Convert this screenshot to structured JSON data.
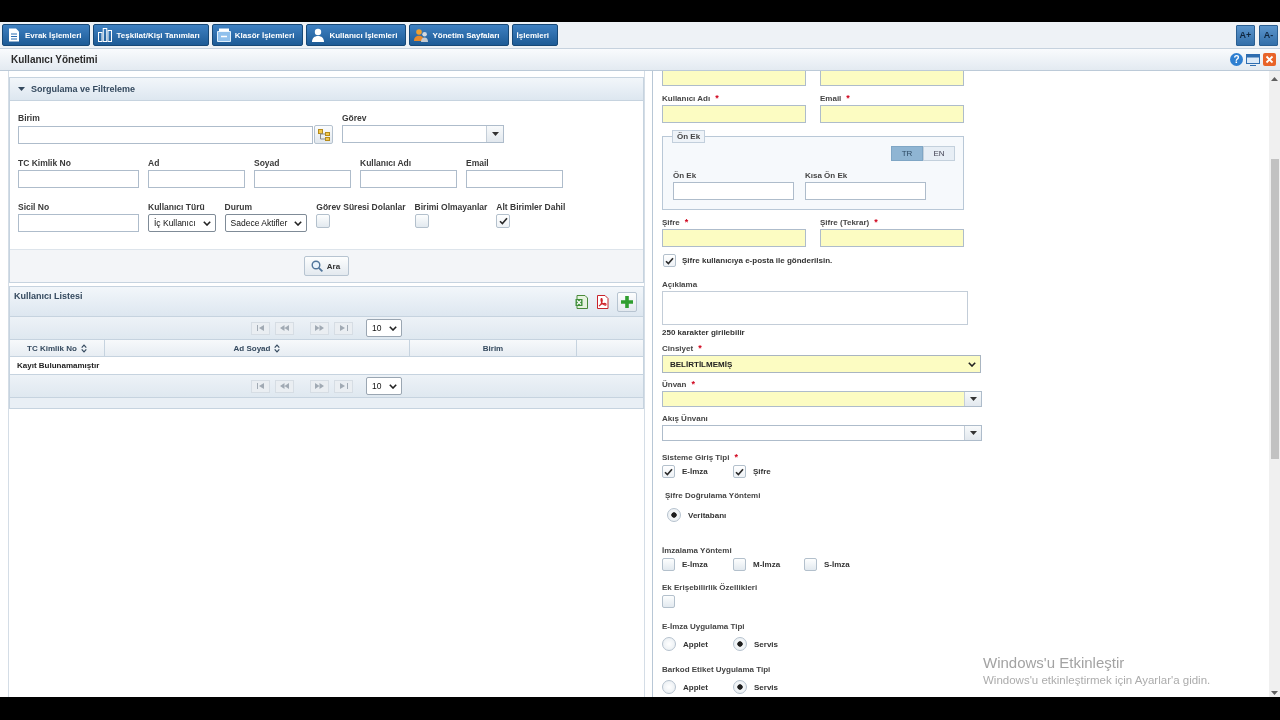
{
  "menu": {
    "items": [
      {
        "label": "Evrak İşlemleri"
      },
      {
        "label": "Teşkilat/Kişi Tanımları"
      },
      {
        "label": "Klasör İşlemleri"
      },
      {
        "label": "Kullanıcı İşlemleri"
      },
      {
        "label": "Yönetim Sayfaları"
      },
      {
        "label": "İşlemleri"
      }
    ],
    "font_size_buttons": [
      "A+",
      "A-"
    ]
  },
  "window": {
    "title": "Kullanıcı Yönetimi",
    "help_button": "?"
  },
  "filter_panel": {
    "title": "Sorgulama ve Filtreleme",
    "expanded": true,
    "rows": [
      [
        {
          "kind": "picker",
          "label": "Birim"
        },
        {
          "kind": "combo",
          "label": "Görev"
        }
      ],
      [
        {
          "kind": "text",
          "label": "TC Kimlik No"
        },
        {
          "kind": "text",
          "label": "Ad"
        },
        {
          "kind": "text",
          "label": "Soyad"
        },
        {
          "kind": "text",
          "label": "Kullanıcı Adı"
        },
        {
          "kind": "text",
          "label": "Email"
        }
      ],
      [
        {
          "kind": "text",
          "label": "Sicil No"
        },
        {
          "kind": "select",
          "label": "Kullanıcı Türü",
          "value": "İç Kullanıcı"
        },
        {
          "kind": "select",
          "label": "Durum",
          "value": "Sadece Aktifler"
        },
        {
          "kind": "checkbox",
          "label": "Görev Süresi Dolanlar",
          "checked": false
        },
        {
          "kind": "checkbox",
          "label": "Birimi Olmayanlar",
          "checked": false
        },
        {
          "kind": "checkbox",
          "label": "Alt Birimler Dahil",
          "checked": true
        }
      ]
    ],
    "search_button": "Ara"
  },
  "user_list": {
    "title": "Kullanıcı Listesi",
    "pagers": [
      {
        "page_size": "10",
        "disabled": true
      },
      {
        "page_size": "10",
        "disabled": true
      }
    ],
    "columns": [
      {
        "label": "TC Kimlik No",
        "sortable": true
      },
      {
        "label": "Ad Soyad",
        "sortable": true
      },
      {
        "label": "Birim",
        "sortable": false
      }
    ],
    "empty_message": "Kayıt Bulunamamıştır"
  },
  "user_form": {
    "sections": [
      {
        "kind": "pair",
        "fields": [
          {
            "required": true
          },
          {
            "required": true
          }
        ]
      },
      {
        "kind": "pair",
        "fields": [
          {
            "label": "Kullanıcı Adı",
            "mark": "*",
            "required": true
          },
          {
            "label": "Email",
            "mark": "*",
            "required": true
          }
        ]
      },
      {
        "kind": "fieldset",
        "legend": "Ön Ek",
        "languages": [
          {
            "label": "TR",
            "selected": true
          },
          {
            "label": "EN",
            "selected": false
          }
        ],
        "fields": [
          {
            "label": "Ön Ek",
            "required": false
          },
          {
            "label": "Kısa Ön Ek",
            "required": false
          }
        ]
      },
      {
        "kind": "pair",
        "fields": [
          {
            "label": "Şifre",
            "mark": "*",
            "required": true
          },
          {
            "label": "Şifre (Tekrar)",
            "mark": "*",
            "required": true
          }
        ]
      },
      {
        "kind": "checkbox",
        "label": "Şifre kullanıcıya e-posta ile gönderilsin.",
        "checked": true
      },
      {
        "kind": "textarea",
        "label": "Açıklama",
        "hint": "250 karakter girilebilir"
      },
      {
        "kind": "select",
        "label": "Cinsiyet",
        "mark": "*",
        "required": true,
        "value": "BELİRTİLMEMİŞ"
      },
      {
        "kind": "combo",
        "label": "Ünvan",
        "mark": "*",
        "required": true
      },
      {
        "kind": "combo",
        "label": "Akış Ünvanı",
        "required": false
      },
      {
        "kind": "checks",
        "label": "Sisteme Giriş Tipi",
        "mark": "*",
        "options": [
          {
            "label": "E-İmza",
            "checked": true
          },
          {
            "label": "Şifre",
            "checked": true
          }
        ]
      },
      {
        "kind": "nested_radios",
        "label": "Şifre Doğrulama Yöntemi",
        "options": [
          {
            "label": "Veritabanı",
            "selected": true
          }
        ]
      },
      {
        "kind": "checks",
        "label": "İmzalama Yöntemi",
        "options": [
          {
            "label": "E-İmza",
            "checked": false
          },
          {
            "label": "M-İmza",
            "checked": false
          },
          {
            "label": "S-İmza",
            "checked": false
          }
        ]
      },
      {
        "kind": "checks",
        "label": "Ek Erişebilirlik Özellikleri",
        "options": [
          {
            "checked": false
          }
        ]
      },
      {
        "kind": "radios",
        "label": "E-İmza Uygulama Tipi",
        "options": [
          {
            "label": "Applet",
            "selected": false
          },
          {
            "label": "Servis",
            "selected": true
          }
        ]
      },
      {
        "kind": "radios",
        "label": "Barkod Etiket Uygulama Tipi",
        "options": [
          {
            "label": "Applet",
            "selected": false
          },
          {
            "label": "Servis",
            "selected": true
          }
        ]
      }
    ]
  },
  "activation_notice": {
    "title": "Windows'u Etkinleştir",
    "message": "Windows'u etkinleştirmek için Ayarlar'a gidin."
  }
}
